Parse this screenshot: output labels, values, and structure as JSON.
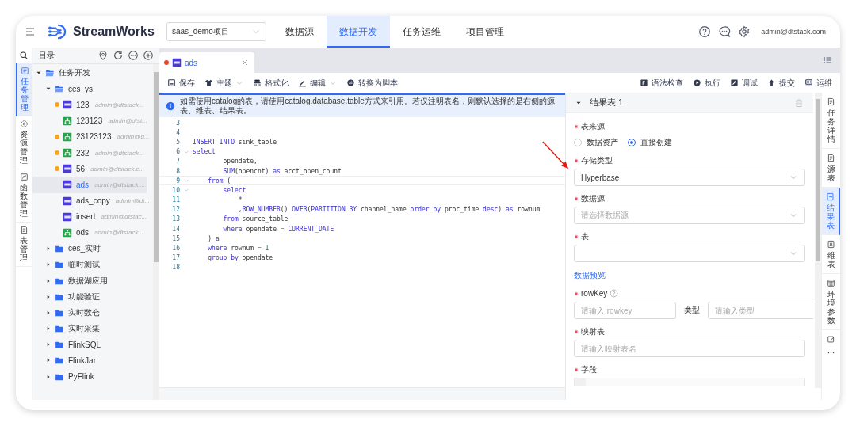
{
  "top_bar": {
    "product": "StreamWorks",
    "project_select": "saas_demo项目",
    "nav": [
      {
        "label": "数据源",
        "selected": false
      },
      {
        "label": "数据开发",
        "selected": true
      },
      {
        "label": "任务运维",
        "selected": false
      },
      {
        "label": "项目管理",
        "selected": false
      }
    ],
    "user": "admin@dtstack.com"
  },
  "left_rail": {
    "items": [
      {
        "label": "任务管理",
        "selected": true
      },
      {
        "label": "资源管理",
        "selected": false
      },
      {
        "label": "函数管理",
        "selected": false
      },
      {
        "label": "表管理",
        "selected": false
      }
    ]
  },
  "catalog": {
    "title": "目录",
    "tree": [
      {
        "label": "任务开发",
        "kind": "folder",
        "expanded": true,
        "selected": false,
        "children": [
          {
            "label": "ces_ys",
            "kind": "folder",
            "expanded": true,
            "selected": false,
            "children": [
              {
                "label": "123",
                "kind": "sql",
                "owner": "admin@dtstack...",
                "modified": true,
                "selected": false
              },
              {
                "label": "123123",
                "kind": "flow",
                "owner": "admin@dtst...",
                "modified": false,
                "selected": false
              },
              {
                "label": "23123123",
                "kind": "flow",
                "owner": "admin@d...",
                "modified": true,
                "selected": false
              },
              {
                "label": "232",
                "kind": "flow",
                "owner": "admin@dtstack...",
                "modified": true,
                "selected": false
              },
              {
                "label": "56",
                "kind": "sql",
                "owner": "admin@dtstack.c...",
                "modified": true,
                "selected": false
              },
              {
                "label": "ads",
                "kind": "sql",
                "owner": "admin@dtstack....",
                "modified": false,
                "selected": true
              },
              {
                "label": "ads_copy",
                "kind": "sql",
                "owner": "admin@dt...",
                "modified": false,
                "selected": false
              },
              {
                "label": "insert",
                "kind": "sql",
                "owner": "admin@dtstac...",
                "modified": false,
                "selected": false
              },
              {
                "label": "ods",
                "kind": "flow",
                "owner": "admin@dtstack...",
                "modified": false,
                "selected": false
              }
            ]
          },
          {
            "label": "ces_实时",
            "kind": "folder",
            "expanded": false,
            "selected": false
          },
          {
            "label": "临时测试",
            "kind": "folder",
            "expanded": false,
            "selected": false
          },
          {
            "label": "数据湖应用",
            "kind": "folder",
            "expanded": false,
            "selected": false
          },
          {
            "label": "功能验证",
            "kind": "folder",
            "expanded": false,
            "selected": false
          },
          {
            "label": "实时数仓",
            "kind": "folder",
            "expanded": false,
            "selected": false
          },
          {
            "label": "实时采集",
            "kind": "folder",
            "expanded": false,
            "selected": false
          },
          {
            "label": "FlinkSQL",
            "kind": "folder",
            "expanded": false,
            "selected": false
          },
          {
            "label": "FlinkJar",
            "kind": "folder",
            "expanded": false,
            "selected": false
          },
          {
            "label": "PyFlink",
            "kind": "folder",
            "expanded": false,
            "selected": false
          }
        ]
      }
    ]
  },
  "editor": {
    "tabs": [
      {
        "label": "ads",
        "kind": "sql",
        "modified": true,
        "selected": true
      }
    ],
    "toolbar_left": [
      {
        "label": "保存",
        "dropdown": false
      },
      {
        "label": "主题",
        "dropdown": true
      },
      {
        "label": "格式化",
        "dropdown": false
      },
      {
        "label": "编辑",
        "dropdown": true
      },
      {
        "label": "转换为脚本",
        "dropdown": false
      }
    ],
    "toolbar_right": [
      {
        "label": "语法检查",
        "dropdown": false
      },
      {
        "label": "执行",
        "dropdown": false
      },
      {
        "label": "调试",
        "dropdown": false
      },
      {
        "label": "提交",
        "dropdown": false
      },
      {
        "label": "运维",
        "dropdown": false
      }
    ],
    "notice": "如需使用catalog的表，请使用catalog.database.table方式来引用。若仅注明表名，则默认选择的是右侧的源表、维表、结果表。",
    "lines": [
      {
        "number": "3",
        "fold": false,
        "current": false
      },
      {
        "number": "4",
        "fold": false,
        "current": false
      },
      {
        "number": "5",
        "fold": false,
        "current": false,
        "segments": [
          {
            "text": "INSERT INTO",
            "kind": "kw"
          },
          {
            "text": " sink_table",
            "kind": "plain"
          }
        ]
      },
      {
        "number": "6",
        "fold": true,
        "current": false,
        "segments": [
          {
            "text": "select",
            "kind": "kw"
          }
        ]
      },
      {
        "number": "7",
        "fold": false,
        "current": false,
        "segments": [
          {
            "text": "        opendate,",
            "kind": "plain"
          }
        ]
      },
      {
        "number": "8",
        "fold": false,
        "current": false,
        "segments": [
          {
            "text": "        SUM",
            "kind": "fn"
          },
          {
            "text": "(opencnt) ",
            "kind": "plain"
          },
          {
            "text": "as",
            "kind": "kw"
          },
          {
            "text": " acct_open_count",
            "kind": "plain"
          }
        ]
      },
      {
        "number": "9",
        "fold": true,
        "current": true,
        "segments": [
          {
            "text": "    from",
            "kind": "kw"
          },
          {
            "text": " (",
            "kind": "plain"
          }
        ]
      },
      {
        "number": "10",
        "fold": true,
        "current": false,
        "segments": [
          {
            "text": "        select",
            "kind": "kw"
          }
        ]
      },
      {
        "number": "11",
        "fold": false,
        "current": false,
        "segments": [
          {
            "text": "            *",
            "kind": "plain"
          }
        ]
      },
      {
        "number": "12",
        "fold": false,
        "current": false,
        "segments": [
          {
            "text": "            ,",
            "kind": "plain"
          },
          {
            "text": "ROW_NUMBER",
            "kind": "fn"
          },
          {
            "text": "() ",
            "kind": "plain"
          },
          {
            "text": "OVER",
            "kind": "kw"
          },
          {
            "text": "(",
            "kind": "plain"
          },
          {
            "text": "PARTITION BY",
            "kind": "kw"
          },
          {
            "text": " channel_name ",
            "kind": "plain"
          },
          {
            "text": "order by",
            "kind": "kw"
          },
          {
            "text": " proc_time ",
            "kind": "plain"
          },
          {
            "text": "desc",
            "kind": "kw"
          },
          {
            "text": ") ",
            "kind": "plain"
          },
          {
            "text": "as",
            "kind": "kw"
          },
          {
            "text": " rownum",
            "kind": "plain"
          }
        ]
      },
      {
        "number": "13",
        "fold": false,
        "current": false,
        "segments": [
          {
            "text": "        from",
            "kind": "kw"
          },
          {
            "text": " source_table",
            "kind": "plain"
          }
        ]
      },
      {
        "number": "14",
        "fold": false,
        "current": false,
        "segments": [
          {
            "text": "        where",
            "kind": "kw"
          },
          {
            "text": " opendate = ",
            "kind": "plain"
          },
          {
            "text": "CURRENT_DATE",
            "kind": "fn"
          }
        ]
      },
      {
        "number": "15",
        "fold": false,
        "current": false,
        "segments": [
          {
            "text": "    ) ",
            "kind": "plain"
          },
          {
            "text": "a",
            "kind": "kw"
          }
        ]
      },
      {
        "number": "16",
        "fold": false,
        "current": false,
        "segments": [
          {
            "text": "    where",
            "kind": "kw"
          },
          {
            "text": " rownum = ",
            "kind": "plain"
          },
          {
            "text": "1",
            "kind": "num"
          }
        ]
      },
      {
        "number": "17",
        "fold": false,
        "current": false,
        "segments": [
          {
            "text": "    group by",
            "kind": "kw"
          },
          {
            "text": " opendate",
            "kind": "plain"
          }
        ]
      },
      {
        "number": "18",
        "fold": false,
        "current": false
      }
    ]
  },
  "result_panel": {
    "title": "结果表 1",
    "expanded": true,
    "fields": [
      {
        "kind": "radio",
        "label": "表来源",
        "required": true,
        "options": [
          {
            "label": "数据资产",
            "selected": false
          },
          {
            "label": "直接创建",
            "selected": true
          }
        ]
      },
      {
        "kind": "select",
        "label": "存储类型",
        "required": true,
        "value": "Hyperbase"
      },
      {
        "kind": "select",
        "label": "数据源",
        "required": true,
        "placeholder": "请选择数据源"
      },
      {
        "kind": "select",
        "label": "表",
        "required": true
      },
      {
        "kind": "link",
        "label": "数据预览"
      },
      {
        "kind": "pair",
        "label": "rowKey",
        "required": true,
        "help": true,
        "placeholder": "请输入 rowkey",
        "label_2": "类型",
        "placeholder_2": "请输入类型"
      },
      {
        "kind": "input",
        "label": "映射表",
        "required": true,
        "placeholder": "请输入映射表名"
      },
      {
        "kind": "table",
        "label": "字段",
        "required": true
      }
    ]
  },
  "right_rail": {
    "items": [
      {
        "label": "任务详情",
        "selected": false
      },
      {
        "label": "源表",
        "selected": false
      },
      {
        "label": "结果表",
        "selected": true
      },
      {
        "label": "维表",
        "selected": false
      },
      {
        "label": "环境参数",
        "selected": false
      }
    ]
  }
}
